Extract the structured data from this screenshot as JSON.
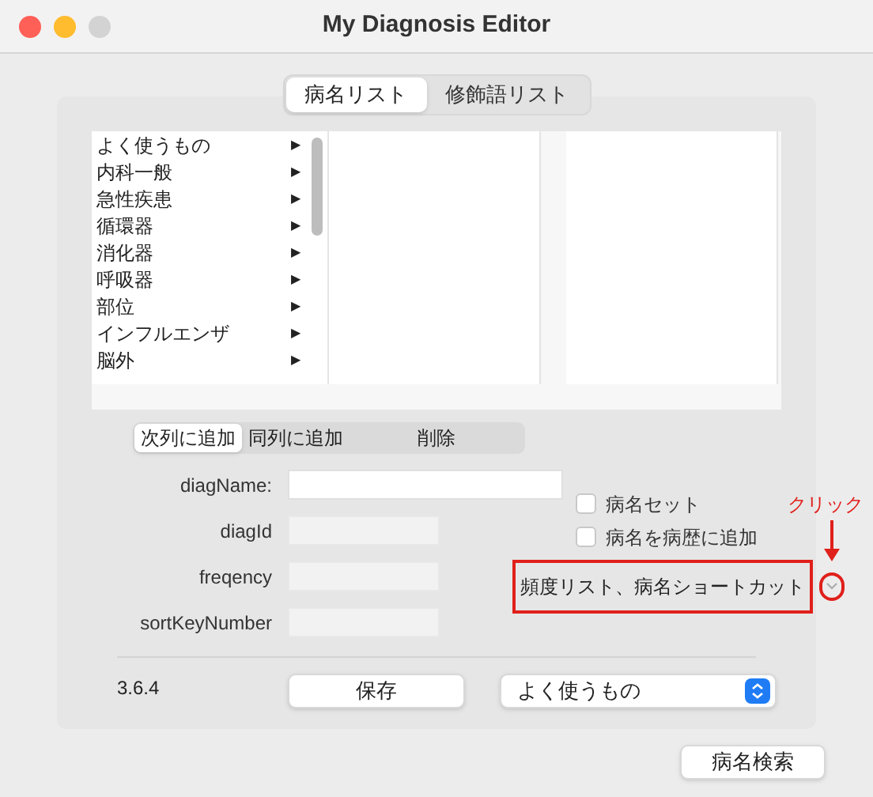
{
  "window": {
    "title": "My Diagnosis Editor"
  },
  "tabs": [
    {
      "label": "病名リスト",
      "selected": true
    },
    {
      "label": "修飾語リスト",
      "selected": false
    }
  ],
  "browser": {
    "items": [
      {
        "label": "よく使うもの",
        "arrow": "▶"
      },
      {
        "label": "内科一般",
        "arrow": "▶"
      },
      {
        "label": "急性疾患",
        "arrow": "▶"
      },
      {
        "label": "循環器",
        "arrow": "▶"
      },
      {
        "label": "消化器",
        "arrow": "▶"
      },
      {
        "label": "呼吸器",
        "arrow": "▶"
      },
      {
        "label": "部位",
        "arrow": "▶"
      },
      {
        "label": "インフルエンザ",
        "arrow": "▶"
      },
      {
        "label": "脳外",
        "arrow": "▶"
      }
    ]
  },
  "actions": [
    {
      "label": "次列に追加",
      "selected": true
    },
    {
      "label": "同列に追加",
      "selected": false
    },
    {
      "label": "削除",
      "selected": false
    }
  ],
  "fields": [
    {
      "label": "diagName:",
      "kind": "editable"
    },
    {
      "label": "diagId",
      "kind": "readonly"
    },
    {
      "label": "freqency",
      "kind": "readonly"
    },
    {
      "label": "sortKeyNumber",
      "kind": "readonly"
    }
  ],
  "checkboxes": [
    {
      "label": "病名セット",
      "checked": false
    },
    {
      "label": "病名を病歴に追加",
      "checked": false
    }
  ],
  "disclosure": {
    "label": "頻度リスト、病名ショートカット",
    "expanded": false
  },
  "annotation": {
    "label": "クリック"
  },
  "version": "3.6.4",
  "save_button": "保存",
  "category_select": {
    "value": "よく使うもの"
  },
  "search_button": "病名検索"
}
